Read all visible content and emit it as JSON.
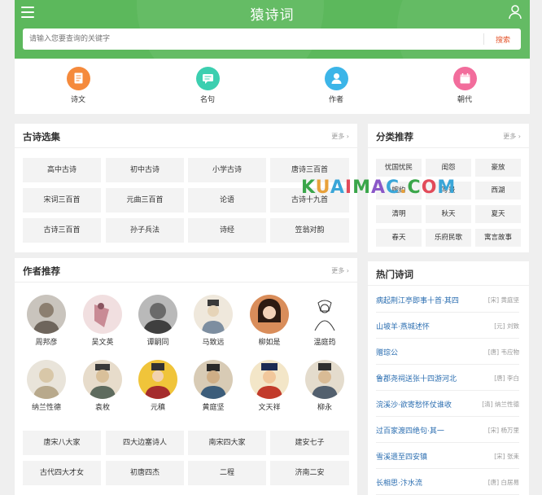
{
  "header": {
    "title": "猿诗词",
    "search_placeholder": "请输入您要查询的关键字",
    "search_button": "搜索",
    "bg_color": "#5cb85c"
  },
  "nav": {
    "items": [
      {
        "label": "诗文",
        "icon": "document-icon",
        "color": "#f58a3c"
      },
      {
        "label": "名句",
        "icon": "message-icon",
        "color": "#3ccfb0"
      },
      {
        "label": "作者",
        "icon": "person-icon",
        "color": "#3cb5e8"
      },
      {
        "label": "朝代",
        "icon": "calendar-icon",
        "color": "#f26d9c"
      }
    ]
  },
  "poetry_collection": {
    "title": "古诗选集",
    "more": "更多",
    "tags": [
      "高中古诗",
      "初中古诗",
      "小学古诗",
      "唐诗三百首",
      "宋词三百首",
      "元曲三百首",
      "论语",
      "古诗十九首",
      "古诗三百首",
      "孙子兵法",
      "诗经",
      "笠翁对韵"
    ]
  },
  "category": {
    "title": "分类推荐",
    "more": "更多",
    "tags": [
      "忧国忧民",
      "闺怨",
      "豪放",
      "婉约",
      "写景",
      "西湖",
      "清明",
      "秋天",
      "夏天",
      "春天",
      "乐府民歌",
      "寓言故事"
    ]
  },
  "authors": {
    "title": "作者推荐",
    "more": "更多",
    "people": [
      "周邦彦",
      "吴文英",
      "谭嗣同",
      "马致远",
      "柳如是",
      "温庭筠",
      "纳兰性德",
      "袁枚",
      "元稹",
      "黄庭坚",
      "文天祥",
      "柳永"
    ],
    "groups": [
      "唐宋八大家",
      "四大边塞诗人",
      "南宋四大家",
      "建安七子",
      "古代四大才女",
      "初唐四杰",
      "二程",
      "济南二安"
    ]
  },
  "hot_poems": {
    "title": "热门诗词",
    "items": [
      {
        "title": "病起荆江亭即事十首·其四",
        "author": "[宋] 黄庭坚"
      },
      {
        "title": "山坡羊·燕城述怀",
        "author": "[元] 刘致"
      },
      {
        "title": "赠琮公",
        "author": "[唐] 韦应物"
      },
      {
        "title": "鲁郡尧祠送张十四游河北",
        "author": "[唐] 李白"
      },
      {
        "title": "浣溪沙·欲寄愁怀仗谁收",
        "author": "[清] 纳兰性德"
      },
      {
        "title": "过百家渡四绝句·其一",
        "author": "[宋] 杨万里"
      },
      {
        "title": "雪溪遗至四安镇",
        "author": "[宋] 张耒"
      },
      {
        "title": "长相思·汴水流",
        "author": "[唐] 白居易"
      }
    ]
  },
  "watermark": "KUAIMAC.COM"
}
